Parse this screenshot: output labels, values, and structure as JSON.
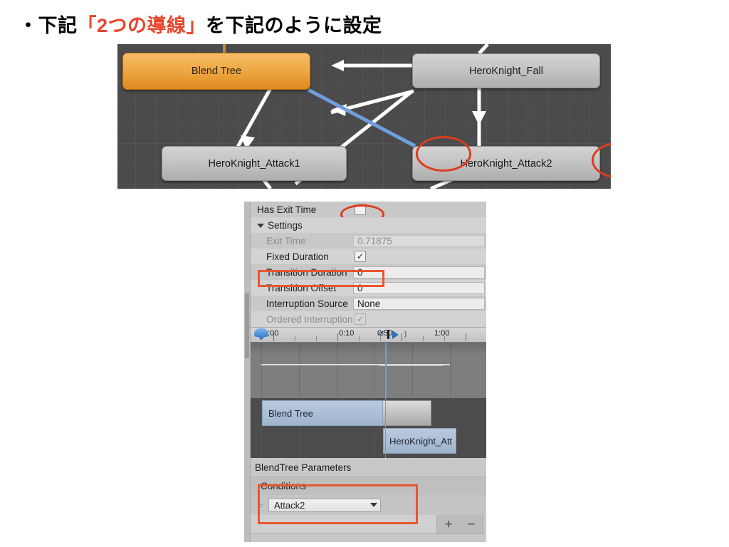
{
  "slide": {
    "title_prefix": "・下記",
    "title_highlight": "「2つの導線」",
    "title_suffix": "を下記のように設定"
  },
  "animator_graph": {
    "nodes": [
      {
        "id": "blend-tree",
        "label": "Blend Tree",
        "style": "orange"
      },
      {
        "id": "heroknight-fall",
        "label": "HeroKnight_Fall",
        "style": "gray"
      },
      {
        "id": "heroknight-attack1",
        "label": "HeroKnight_Attack1",
        "style": "gray"
      },
      {
        "id": "heroknight-attack2",
        "label": "HeroKnight_Attack2",
        "style": "gray"
      }
    ],
    "annotation_color": "#dd3d1e",
    "selected_transition_color": "#6f9ede",
    "transition_color": "#ffffff",
    "background_color": "#4b4b4b"
  },
  "inspector": {
    "properties": [
      {
        "label": "Has Exit Time",
        "type": "checkbox",
        "checked": false,
        "dim": false,
        "highlighted": true
      },
      {
        "label": "Settings",
        "type": "foldout",
        "expanded": true
      },
      {
        "label": "Exit Time",
        "type": "text",
        "value": "0.71875",
        "dim": true,
        "indent": true
      },
      {
        "label": "Fixed Duration",
        "type": "checkbox",
        "checked": true,
        "dim": false,
        "indent": true
      },
      {
        "label": "Transition Duration",
        "type": "text",
        "value": "0",
        "dim": false,
        "indent": true,
        "highlighted": true
      },
      {
        "label": "Transition Offset",
        "type": "text",
        "value": "0",
        "dim": false,
        "indent": true
      },
      {
        "label": "Interruption Source",
        "type": "text",
        "value": "None",
        "dim": false,
        "indent": true
      },
      {
        "label": "Ordered Interruption",
        "type": "checkbox",
        "checked": true,
        "dim": true,
        "indent": true
      }
    ],
    "checkmark_glyph": "✓",
    "timeline": {
      "ticks": [
        "0:00",
        "0:10",
        "0:50",
        "1:00"
      ],
      "playhead_label": "0:50",
      "clips": [
        {
          "name": "Blend Tree",
          "kind": "source"
        },
        {
          "name": "HeroKnight_Att",
          "kind": "destination"
        }
      ]
    },
    "blendtree_parameters_label": "BlendTree Parameters",
    "conditions": {
      "header": "Conditions",
      "rows": [
        {
          "parameter": "Attack2",
          "drag_handle": "="
        }
      ],
      "add_label": "+",
      "remove_label": "−",
      "highlighted": true
    }
  }
}
